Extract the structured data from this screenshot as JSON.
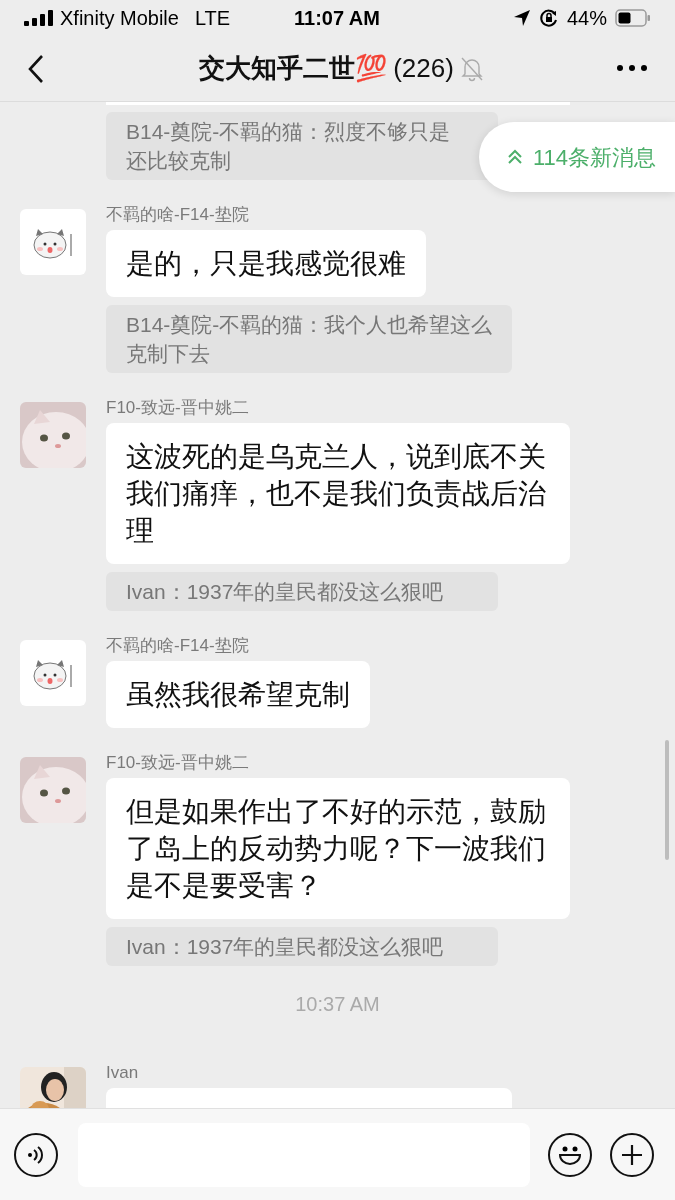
{
  "status_bar": {
    "carrier": "Xfinity Mobile",
    "network": "LTE",
    "time": "11:07 AM",
    "battery": "44%"
  },
  "header": {
    "title": "交大知乎二世💯",
    "member_count": "(226)",
    "muted": true
  },
  "new_messages_badge": {
    "text": "114条新消息"
  },
  "chat": [
    {
      "kind": "quote",
      "lines": [
        "B14-奠院-不羁的猫：烈度不够只是",
        "还比较克制"
      ]
    },
    {
      "kind": "message",
      "sender": "不羁的啥-F14-垫院",
      "text": "是的，只是我感觉很难"
    },
    {
      "kind": "quote",
      "lines": [
        "B14-奠院-不羁的猫：我个人也希望这么",
        "克制下去"
      ]
    },
    {
      "kind": "message",
      "sender": "F10-致远-晋中姚二",
      "text": "这波死的是乌克兰人，说到底不关我们痛痒，也不是我们负责战后治理"
    },
    {
      "kind": "quote",
      "lines": [
        "Ivan：1937年的皇民都没这么狠吧"
      ]
    },
    {
      "kind": "message",
      "sender": "不羁的啥-F14-垫院",
      "text": "虽然我很希望克制"
    },
    {
      "kind": "message",
      "sender": "F10-致远-晋中姚二",
      "text": "但是如果作出了不好的示范，鼓励了岛上的反动势力呢？下一波我们是不是要受害？"
    },
    {
      "kind": "quote",
      "lines": [
        "Ivan：1937年的皇民都没这么狠吧"
      ]
    },
    {
      "kind": "time",
      "text": "10:37 AM"
    },
    {
      "kind": "message",
      "sender": "Ivan"
    }
  ]
}
